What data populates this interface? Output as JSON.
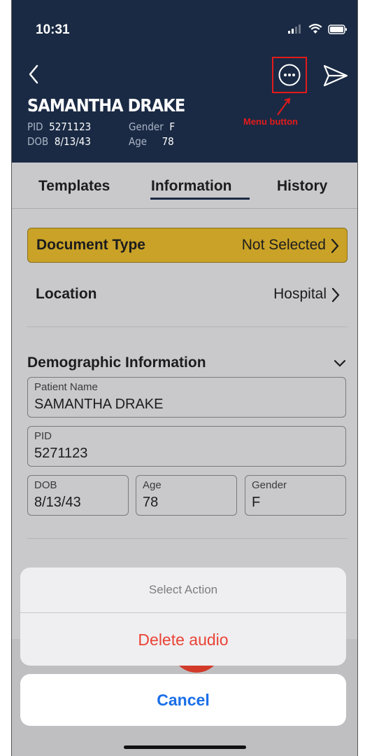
{
  "status_bar": {
    "time": "10:31"
  },
  "header": {
    "patient_name": "SAMANTHA DRAKE",
    "pid_label": "PID",
    "pid_value": "5271123",
    "dob_label": "DOB",
    "dob_value": "8/13/43",
    "gender_label": "Gender",
    "gender_value": "F",
    "age_label": "Age",
    "age_value": "78",
    "annotation": "Menu button"
  },
  "tabs": [
    {
      "label": "Templates"
    },
    {
      "label": "Information"
    },
    {
      "label": "History"
    }
  ],
  "active_tab": "Information",
  "rows": {
    "document_type": {
      "label": "Document Type",
      "value": "Not Selected"
    },
    "location": {
      "label": "Location",
      "value": "Hospital"
    }
  },
  "demographics": {
    "title": "Demographic Information",
    "patient_name": {
      "label": "Patient Name",
      "value": "SAMANTHA DRAKE"
    },
    "pid": {
      "label": "PID",
      "value": "5271123"
    },
    "dob": {
      "label": "DOB",
      "value": "8/13/43"
    },
    "age": {
      "label": "Age",
      "value": "78"
    },
    "gender": {
      "label": "Gender",
      "value": "F"
    }
  },
  "action_sheet": {
    "title": "Select Action",
    "action": "Delete audio",
    "cancel": "Cancel"
  },
  "colors": {
    "header_bg": "#1a2a44",
    "document_type_bg": "#c9a227",
    "destructive": "#ea4335",
    "cancel": "#1a6fe8",
    "annotation": "#e21b1b"
  }
}
